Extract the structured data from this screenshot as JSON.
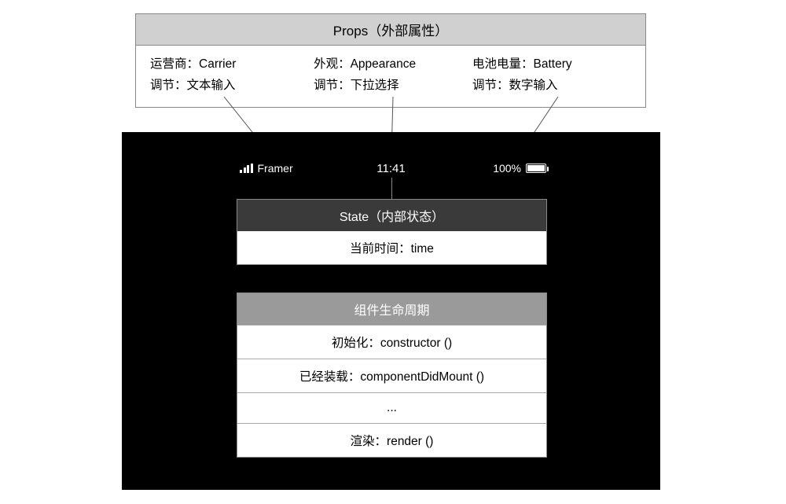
{
  "props": {
    "header": "Props（外部属性）",
    "cols": [
      {
        "line1": "运营商：Carrier",
        "line2": "调节：文本输入"
      },
      {
        "line1": "外观：Appearance",
        "line2": "调节：下拉选择"
      },
      {
        "line1": "电池电量：Battery",
        "line2": "调节：数字输入"
      }
    ]
  },
  "statusbar": {
    "carrier": "Framer",
    "time": "11:41",
    "battery_pct": "100%"
  },
  "state": {
    "header": "State（内部状态）",
    "body": "当前时间：time"
  },
  "lifecycle": {
    "header": "组件生命周期",
    "rows": [
      "初始化：constructor ()",
      "已经装载：componentDidMount ()",
      "...",
      "渲染：render ()"
    ]
  }
}
